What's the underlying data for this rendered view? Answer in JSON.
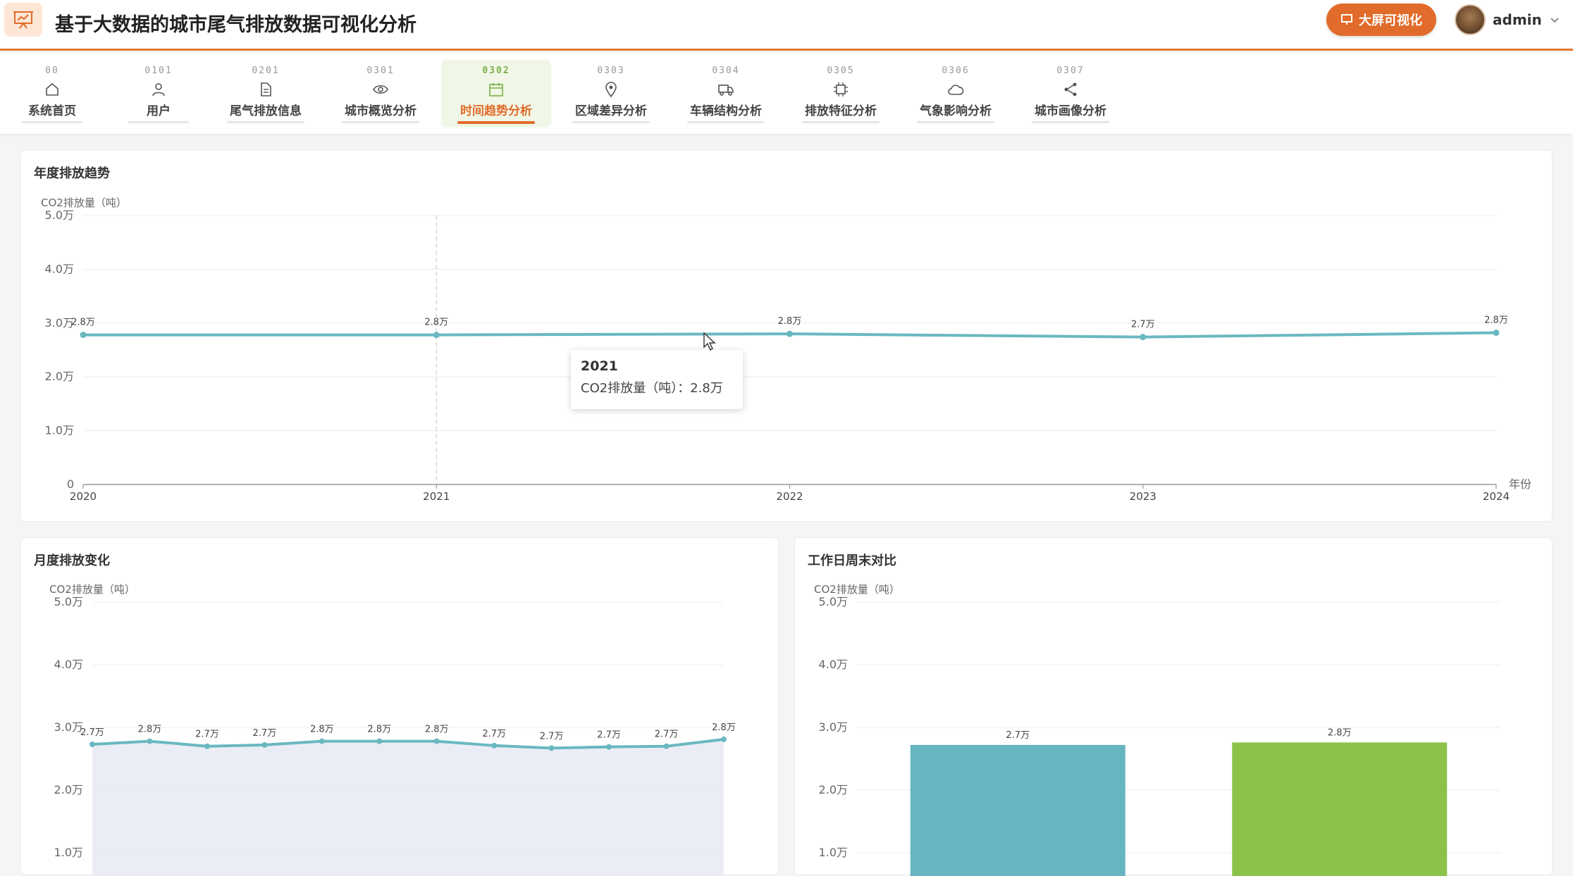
{
  "app": {
    "title": "基于大数据的城市尾气排放数据可视化分析",
    "big_screen_label": "大屏可视化",
    "user": "admin"
  },
  "nav": [
    {
      "code": "00",
      "label": "系统首页",
      "icon": "home-icon"
    },
    {
      "code": "0101",
      "label": "用户",
      "icon": "user-icon"
    },
    {
      "code": "0201",
      "label": "尾气排放信息",
      "icon": "document-icon"
    },
    {
      "code": "0301",
      "label": "城市概览分析",
      "icon": "eye-icon"
    },
    {
      "code": "0302",
      "label": "时间趋势分析",
      "icon": "calendar-icon",
      "active": true
    },
    {
      "code": "0303",
      "label": "区域差异分析",
      "icon": "location-pin-icon"
    },
    {
      "code": "0304",
      "label": "车辆结构分析",
      "icon": "truck-icon"
    },
    {
      "code": "0305",
      "label": "排放特征分析",
      "icon": "chip-icon"
    },
    {
      "code": "0306",
      "label": "气象影响分析",
      "icon": "cloud-icon"
    },
    {
      "code": "0307",
      "label": "城市画像分析",
      "icon": "share-icon"
    }
  ],
  "colors": {
    "accent": "#e16b2a",
    "line": "#6ab8c1",
    "bar1": "#66b5c0",
    "bar2": "#8bc34a",
    "active_bg": "#f0f7e6"
  },
  "tooltip": {
    "title": "2021",
    "row": "CO2排放量（吨）：2.8万"
  },
  "chart_data": [
    {
      "type": "line",
      "title": "年度排放趋势",
      "ylabel": "CO2排放量（吨）",
      "xlabel": "年份",
      "categories": [
        "2020",
        "2021",
        "2022",
        "2023",
        "2024"
      ],
      "values": [
        27800,
        27800,
        28000,
        27400,
        28200
      ],
      "data_labels": [
        "2.8万",
        "2.8万",
        "2.8万",
        "2.7万",
        "2.8万"
      ],
      "yticks": [
        "0",
        "1.0万",
        "2.0万",
        "3.0万",
        "4.0万",
        "5.0万"
      ],
      "ylim": [
        0,
        50000
      ],
      "grid": true
    },
    {
      "type": "area",
      "title": "月度排放变化",
      "ylabel": "CO2排放量（吨）",
      "values": [
        27300,
        27800,
        27000,
        27200,
        27800,
        27800,
        27800,
        27100,
        26700,
        26900,
        27000,
        28100
      ],
      "data_labels": [
        "2.7万",
        "2.8万",
        "2.7万",
        "2.7万",
        "2.8万",
        "2.8万",
        "2.8万",
        "2.7万",
        "2.7万",
        "2.7万",
        "2.7万",
        "2.8万"
      ],
      "yticks": [
        "1.0万",
        "2.0万",
        "3.0万",
        "4.0万",
        "5.0万"
      ],
      "ylim": [
        0,
        50000
      ],
      "grid": true
    },
    {
      "type": "bar",
      "title": "工作日周末对比",
      "ylabel": "CO2排放量（吨）",
      "values": [
        27200,
        27600
      ],
      "data_labels": [
        "2.7万",
        "2.8万"
      ],
      "colors": [
        "#66b5c0",
        "#8bc34a"
      ],
      "yticks": [
        "1.0万",
        "2.0万",
        "3.0万",
        "4.0万",
        "5.0万"
      ],
      "ylim": [
        0,
        50000
      ],
      "grid": true
    }
  ]
}
